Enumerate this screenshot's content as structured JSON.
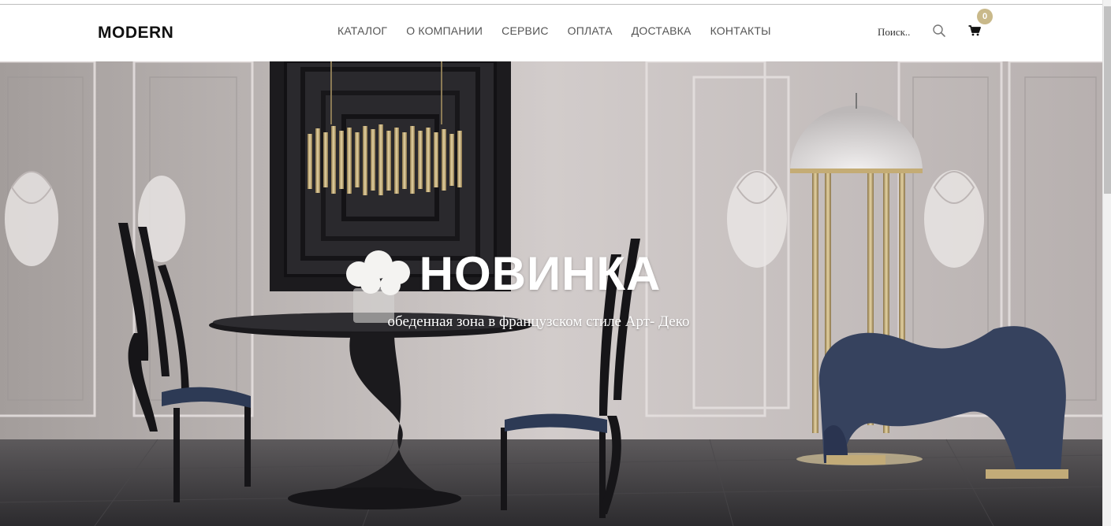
{
  "header": {
    "logo": "MODERN",
    "nav": [
      "КАТАЛОГ",
      "О КОМПАНИИ",
      "СЕРВИС",
      "ОПЛАТА",
      "ДОСТАВКА",
      "КОНТАКТЫ"
    ],
    "search": {
      "placeholder": "Поиск.."
    },
    "cart": {
      "count": "0"
    }
  },
  "hero": {
    "title": "НОВИНКА",
    "subtitle": "обеденная зона в французском стиле Арт- Деко"
  },
  "colors": {
    "accent": "#c9b98a",
    "nav_text": "#555555",
    "hero_text": "#ffffff"
  },
  "icons": [
    "search-icon",
    "cart-icon"
  ]
}
